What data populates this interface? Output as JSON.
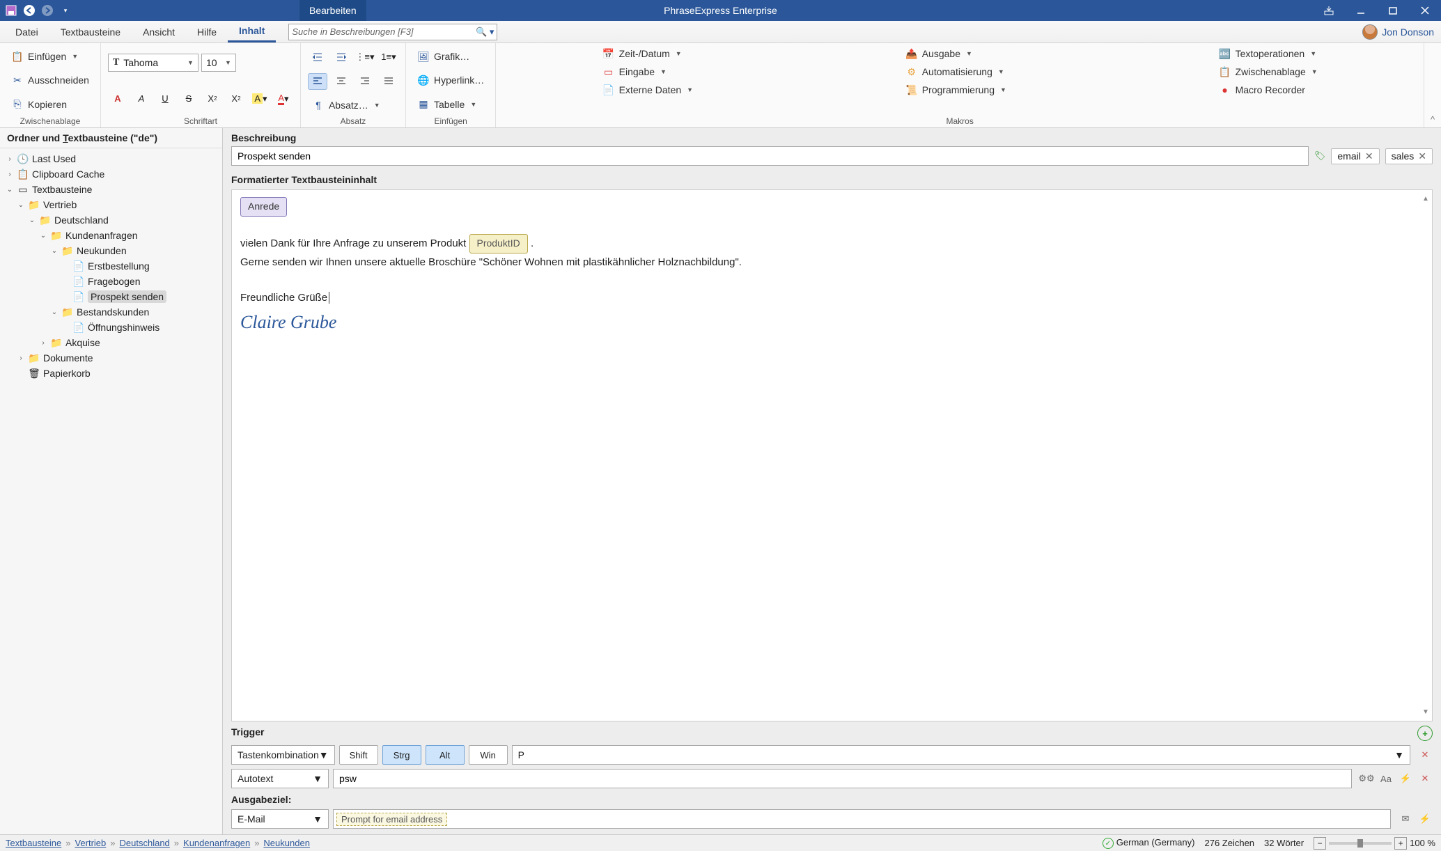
{
  "titlebar": {
    "context": "Bearbeiten",
    "app": "PhraseExpress Enterprise"
  },
  "user": {
    "name": "Jon Donson"
  },
  "menu": {
    "datei": "Datei",
    "textbausteine": "Textbausteine",
    "ansicht": "Ansicht",
    "hilfe": "Hilfe",
    "inhalt": "Inhalt"
  },
  "search": {
    "placeholder": "Suche in Beschreibungen [F3]"
  },
  "ribbon": {
    "clipboard": {
      "einfuegen": "Einfügen",
      "ausschneiden": "Ausschneiden",
      "kopieren": "Kopieren",
      "title": "Zwischenablage"
    },
    "font": {
      "family": "Tahoma",
      "size": "10",
      "title": "Schriftart"
    },
    "para": {
      "absatz": "Absatz…",
      "title": "Absatz"
    },
    "insert": {
      "grafik": "Grafik…",
      "hyperlink": "Hyperlink…",
      "tabelle": "Tabelle",
      "title": "Einfügen"
    },
    "macros": {
      "zeit": "Zeit-/Datum",
      "eingabe": "Eingabe",
      "externe": "Externe Daten",
      "ausgabe": "Ausgabe",
      "auto": "Automatisierung",
      "prog": "Programmierung",
      "textop": "Textoperationen",
      "zwisch": "Zwischenablage",
      "recorder": "Macro Recorder",
      "title": "Makros"
    }
  },
  "tree": {
    "header": "Ordner und Textbausteine (\"de\")",
    "lastused": "Last Used",
    "clipboard": "Clipboard Cache",
    "root": "Textbausteine",
    "vertrieb": "Vertrieb",
    "deutschland": "Deutschland",
    "kundenanfragen": "Kundenanfragen",
    "neukunden": "Neukunden",
    "erstbestellung": "Erstbestellung",
    "fragebogen": "Fragebogen",
    "prospekt": "Prospekt senden",
    "bestand": "Bestandskunden",
    "oeffnung": "Öffnungshinweis",
    "akquise": "Akquise",
    "dokumente": "Dokumente",
    "papierkorb": "Papierkorb"
  },
  "editor": {
    "desc_label": "Beschreibung",
    "desc_value": "Prospekt senden",
    "tag1": "email",
    "tag2": "sales",
    "content_label": "Formatierter Textbausteininhalt",
    "chip_anrede": "Anrede",
    "line1a": "vielen Dank für Ihre Anfrage zu unserem Produkt ",
    "chip_produkt": "ProduktID",
    "line1b": ".",
    "line2": "Gerne senden wir Ihnen unsere aktuelle Broschüre \"Schöner Wohnen mit plastikähnlicher Holznachbildung\".",
    "line3": "Freundliche Grüße",
    "signature": "Claire Grube"
  },
  "trigger": {
    "label": "Trigger",
    "combo1": "Tastenkombination",
    "shift": "Shift",
    "strg": "Strg",
    "alt": "Alt",
    "win": "Win",
    "key": "P",
    "combo2": "Autotext",
    "autotext": "psw",
    "out_label": "Ausgabeziel:",
    "out_combo": "E-Mail",
    "out_token": "Prompt for email address"
  },
  "status": {
    "crumbs": [
      "Textbausteine",
      "Vertrieb",
      "Deutschland",
      "Kundenanfragen",
      "Neukunden"
    ],
    "lang": "German (Germany)",
    "chars": "276 Zeichen",
    "words": "32 Wörter",
    "zoom": "100 %"
  }
}
